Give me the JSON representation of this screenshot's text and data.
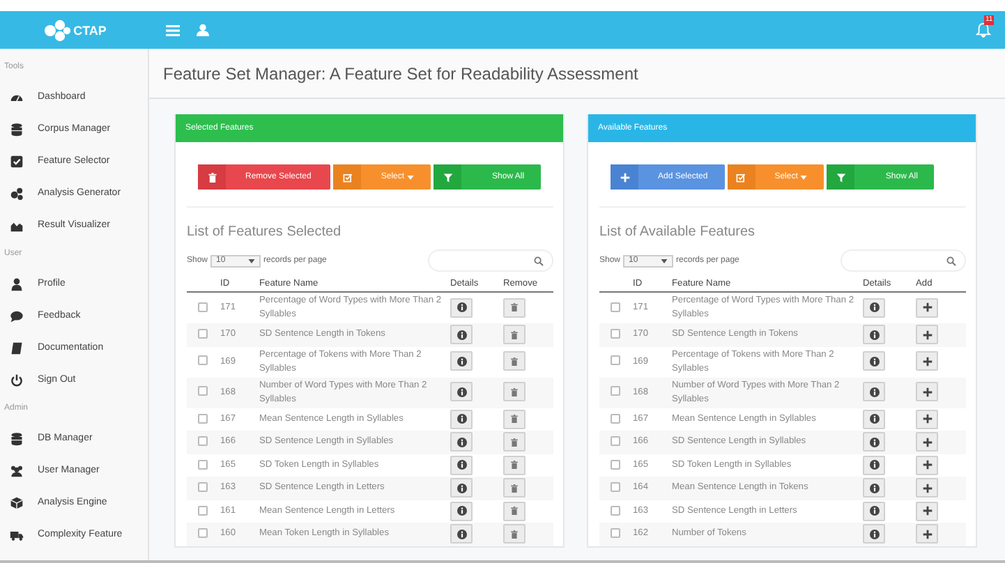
{
  "header": {
    "logo": "CTAP",
    "notification_count": "11"
  },
  "sidebar": {
    "sections": [
      {
        "title": "Tools",
        "items": [
          {
            "label": "Dashboard"
          },
          {
            "label": "Corpus Manager"
          },
          {
            "label": "Feature Selector"
          },
          {
            "label": "Analysis Generator"
          },
          {
            "label": "Result Visualizer"
          }
        ]
      },
      {
        "title": "User",
        "items": [
          {
            "label": "Profile"
          },
          {
            "label": "Feedback"
          },
          {
            "label": "Documentation"
          },
          {
            "label": "Sign Out"
          }
        ]
      },
      {
        "title": "Admin",
        "items": [
          {
            "label": "DB Manager"
          },
          {
            "label": "User Manager"
          },
          {
            "label": "Analysis Engine"
          },
          {
            "label": "Complexity Feature"
          }
        ]
      }
    ]
  },
  "page_title": "Feature Set Manager: A Feature Set for Readability Assessment",
  "panels": [
    {
      "title": "Selected Features",
      "color": "#2dbe4e",
      "kind": "remove",
      "buttons": [
        {
          "kind": "remove",
          "label": "Remove Selected"
        },
        {
          "kind": "select",
          "label": "Select"
        },
        {
          "kind": "filter",
          "label": "Show All"
        }
      ],
      "list_title": "List of Features Selected",
      "show": "Show",
      "page_size": "10",
      "per_page": "records per page",
      "columns": [
        "ID",
        "Feature Name",
        "Details",
        "Remove"
      ],
      "rows": [
        {
          "checked": false,
          "id": "171",
          "name": "Percentage of Word Types with More Than 2 Syllables"
        },
        {
          "checked": false,
          "id": "170",
          "name": "SD Sentence Length in Tokens"
        },
        {
          "checked": false,
          "id": "169",
          "name": "Percentage of Tokens with More Than 2 Syllables"
        },
        {
          "checked": false,
          "id": "168",
          "name": "Number of Word Types with More Than 2 Syllables"
        },
        {
          "checked": false,
          "id": "167",
          "name": "Mean Sentence Length in Syllables"
        },
        {
          "checked": false,
          "id": "166",
          "name": "SD Sentence Length in Syllables"
        },
        {
          "checked": false,
          "id": "165",
          "name": "SD Token Length in Syllables"
        },
        {
          "checked": false,
          "id": "163",
          "name": "SD Sentence Length in Letters"
        },
        {
          "checked": false,
          "id": "161",
          "name": "Mean Sentence Length in Letters"
        },
        {
          "checked": false,
          "id": "160",
          "name": "Mean Token Length in Syllables"
        }
      ]
    },
    {
      "title": "Available Features",
      "color": "#29b6e6",
      "kind": "add",
      "buttons": [
        {
          "kind": "add",
          "label": "Add Selected"
        },
        {
          "kind": "select",
          "label": "Select"
        },
        {
          "kind": "filter",
          "label": "Show All"
        }
      ],
      "list_title": "List of Available Features",
      "show": "Show",
      "page_size": "10",
      "per_page": "records per page",
      "columns": [
        "ID",
        "Feature Name",
        "Details",
        "Add"
      ],
      "rows": [
        {
          "checked": false,
          "id": "171",
          "name": "Percentage of Word Types with More Than 2 Syllables"
        },
        {
          "checked": false,
          "id": "170",
          "name": "SD Sentence Length in Tokens"
        },
        {
          "checked": false,
          "id": "169",
          "name": "Percentage of Tokens with More Than 2 Syllables"
        },
        {
          "checked": false,
          "id": "168",
          "name": "Number of Word Types with More Than 2 Syllables"
        },
        {
          "checked": false,
          "id": "167",
          "name": "Mean Sentence Length in Syllables"
        },
        {
          "checked": false,
          "id": "166",
          "name": "SD Sentence Length in Syllables"
        },
        {
          "checked": false,
          "id": "165",
          "name": "SD Token Length in Syllables"
        },
        {
          "checked": false,
          "id": "164",
          "name": "Mean Sentence Length in Tokens"
        },
        {
          "checked": false,
          "id": "163",
          "name": "SD Sentence Length in Letters"
        },
        {
          "checked": false,
          "id": "162",
          "name": "Number of Tokens"
        }
      ]
    }
  ]
}
